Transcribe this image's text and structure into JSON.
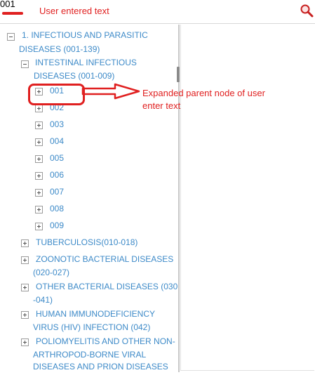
{
  "search": {
    "value": "001"
  },
  "annotations": {
    "entered_text": "User entered text",
    "expanded_parent": "Expanded parent node of user enter text"
  },
  "tree": {
    "root": {
      "line1": "1. INFECTIOUS AND PARASITIC",
      "line2": "DISEASES (001-139)",
      "expanded": true
    },
    "group": {
      "line1": "INTESTINAL INFECTIOUS",
      "line2": "DISEASES (001-009)",
      "expanded": true
    },
    "codes": [
      "001",
      "002",
      "003",
      "004",
      "005",
      "006",
      "007",
      "008",
      "009"
    ],
    "siblings": [
      {
        "line1": "TUBERCULOSIS(010-018)"
      },
      {
        "line1": "ZOONOTIC BACTERIAL DISEASES",
        "line2": "(020-027)"
      },
      {
        "line1": "OTHER BACTERIAL DISEASES (030",
        "line2": "-041)"
      },
      {
        "line1": "HUMAN IMMUNODEFICIENCY",
        "line2": "VIRUS (HIV) INFECTION (042)"
      },
      {
        "line1": "POLIOMYELITIS AND OTHER NON-",
        "line2": "ARTHROPOD-BORNE VIRAL",
        "line3": "DISEASES AND PRION DISEASES"
      }
    ]
  },
  "colors": {
    "link": "#3d8ac8",
    "annotation": "#e02020"
  },
  "icons": {
    "search": "magnifier-icon"
  }
}
